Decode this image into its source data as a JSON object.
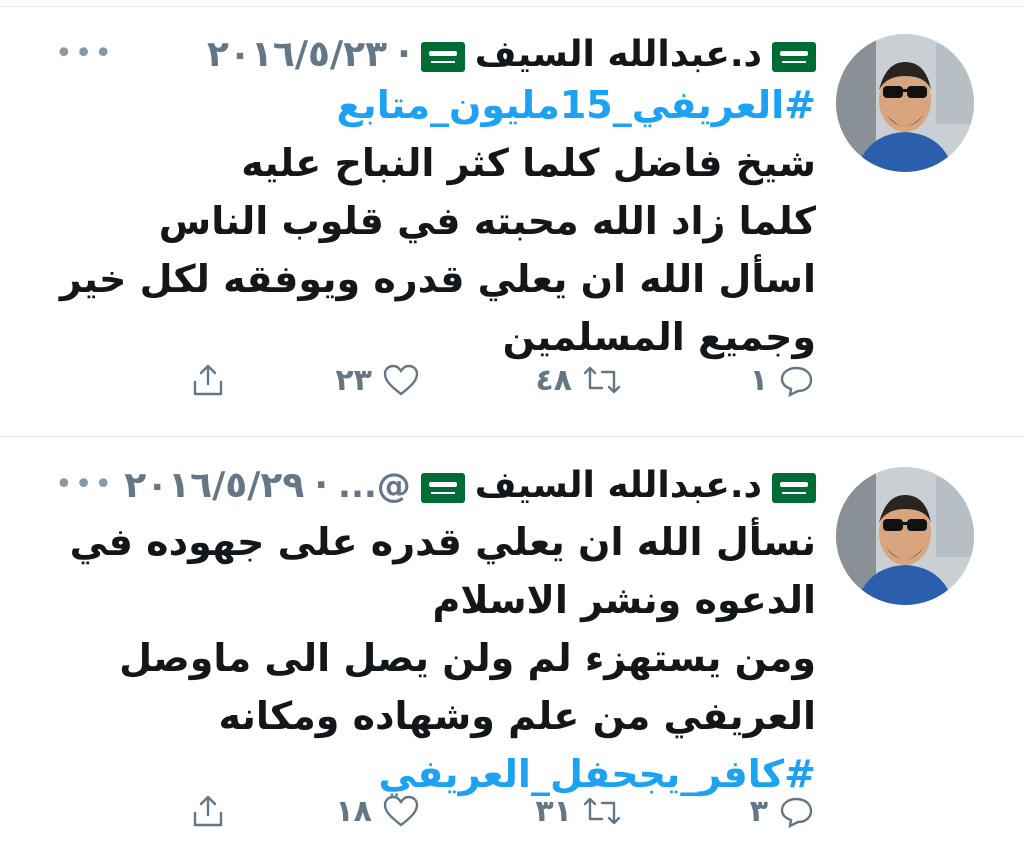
{
  "colors": {
    "accent": "#1da1f2",
    "muted": "#657786",
    "text": "#14171a",
    "divider": "#e6ecf0",
    "flag": "#006c35"
  },
  "tweets": [
    {
      "author": "د.عبدالله السيف",
      "handle": "",
      "date": "٢٠١٦/٥/٢٣",
      "more": "•••",
      "lines": [
        {
          "text": "#العريفي_15مليون_متابع",
          "hashtag": true
        },
        {
          "text": "شيخ فاضل كلما كثر النباح عليه",
          "hashtag": false
        },
        {
          "text": "كلما زاد الله محبته في قلوب الناس",
          "hashtag": false
        },
        {
          "text": "اسأل الله ان يعلي قدره ويوفقه لكل خير",
          "hashtag": false
        },
        {
          "text": "وجميع المسلمين",
          "hashtag": false
        }
      ],
      "replies": "١",
      "retweets": "٤٨",
      "likes": "٢٣",
      "icons": [
        "reply-icon",
        "retweet-icon",
        "like-icon",
        "share-icon"
      ]
    },
    {
      "author": "د.عبدالله السيف",
      "handle": "@...",
      "date": "٢٠١٦/٥/٢٩",
      "more": "•••",
      "lines": [
        {
          "text": "نسأل الله ان يعلي قدره على جهوده في",
          "hashtag": false
        },
        {
          "text": "الدعوه ونشر الاسلام",
          "hashtag": false
        },
        {
          "text": "ومن يستهزء لم ولن يصل الى ماوصل",
          "hashtag": false
        },
        {
          "text": "العريفي من علم وشهاده ومكانه",
          "hashtag": false
        },
        {
          "text": "#كافر_يجحفل_العريفي",
          "hashtag": true
        }
      ],
      "replies": "٣",
      "retweets": "٣١",
      "likes": "١٨",
      "icons": [
        "reply-icon",
        "retweet-icon",
        "like-icon",
        "share-icon"
      ]
    }
  ],
  "separator": "·"
}
